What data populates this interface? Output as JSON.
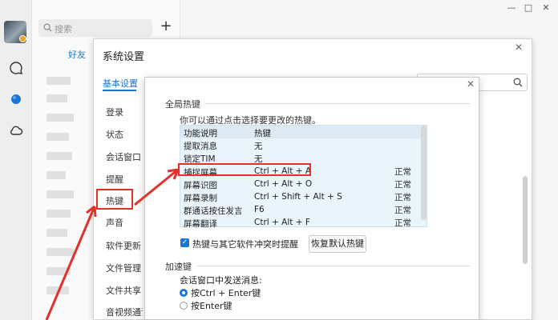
{
  "main": {
    "search_placeholder": "搜索",
    "add_label": "+",
    "tab_friends": "好友",
    "window_controls": {
      "minimize": "—",
      "maximize": "□",
      "close": "✕"
    }
  },
  "settings": {
    "title": "系统设置",
    "close": "✕",
    "nav_active": "基本设置",
    "nav_items": [
      "登录",
      "状态",
      "会话窗口",
      "提醒",
      "热键",
      "声音",
      "软件更新",
      "文件管理",
      "文件共享",
      "音视频通话"
    ]
  },
  "hotkey_dialog": {
    "close": "✕",
    "section_global": "全局热键",
    "hint": "你可以通过点击选择要更改的热键。",
    "table_headers": [
      "功能说明",
      "热键"
    ],
    "rows": [
      {
        "func": "提取消息",
        "key": "无",
        "status": ""
      },
      {
        "func": "锁定TIM",
        "key": "无",
        "status": ""
      },
      {
        "func": "捕捉屏幕",
        "key": "Ctrl + Alt + A",
        "status": "正常"
      },
      {
        "func": "屏幕识图",
        "key": "Ctrl + Alt + O",
        "status": "正常"
      },
      {
        "func": "屏幕录制",
        "key": "Ctrl + Shift + Alt + S",
        "status": "正常"
      },
      {
        "func": "群通话按住发言",
        "key": "F6",
        "status": "正常"
      },
      {
        "func": "屏幕翻译",
        "key": "Ctrl + Alt + F",
        "status": "正常"
      }
    ],
    "conflict_checkbox": "热键与其它软件冲突时提醒",
    "conflict_checked": "✓",
    "restore_button": "恢复默认热键",
    "section_accel": "加速键",
    "send_label": "会话窗口中发送消息:",
    "send_options": [
      "按Ctrl + Enter键",
      "按Enter键"
    ],
    "send_selected": 0
  },
  "colors": {
    "accent": "#1b75d6",
    "highlight": "#e3302b"
  }
}
